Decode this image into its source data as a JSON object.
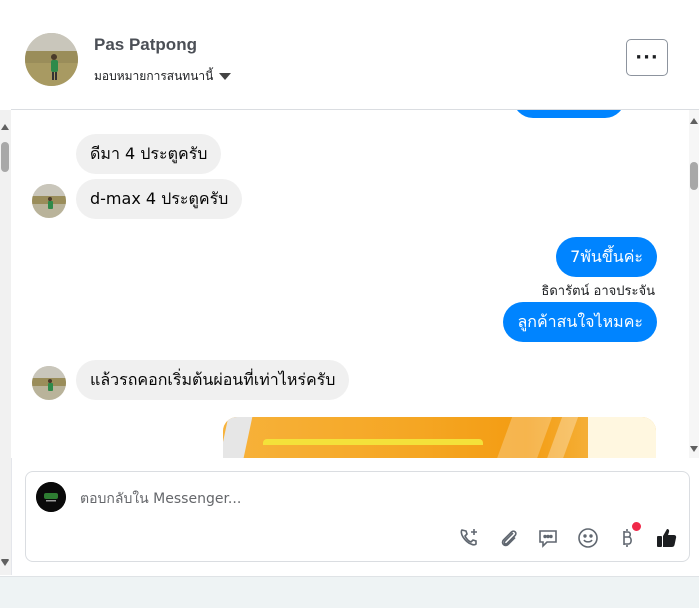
{
  "header": {
    "name": "Pas Patpong",
    "assign_label": "มอบหมายการสนทนานี้",
    "more_label": "···"
  },
  "messages": [
    {
      "side": "in",
      "text": "ดีมา 4 ประตูครับ"
    },
    {
      "side": "in",
      "text": "d-max 4 ประตูครับ"
    },
    {
      "side": "out",
      "text": "7พันขึ้นค่ะ"
    },
    {
      "side": "out_sender",
      "text": "ธิดารัตน์ อาจประจัน"
    },
    {
      "side": "out",
      "text": "ลูกค้าสนใจไหมคะ"
    },
    {
      "side": "in",
      "text": "แล้วรถคอกเริ่มต้นผ่อนที่เท่าไหร่ครับ"
    }
  ],
  "composer": {
    "placeholder": "ตอบกลับใน Messenger..."
  },
  "toolbar_icons": [
    "phone-plus-icon",
    "paperclip-icon",
    "saved-reply-icon",
    "emoji-icon",
    "baht-payment-icon",
    "thumbs-up-icon"
  ],
  "colors": {
    "outgoing_bubble": "#0084ff",
    "incoming_bubble": "#f0f0f0",
    "notification_dot": "#f02849"
  }
}
